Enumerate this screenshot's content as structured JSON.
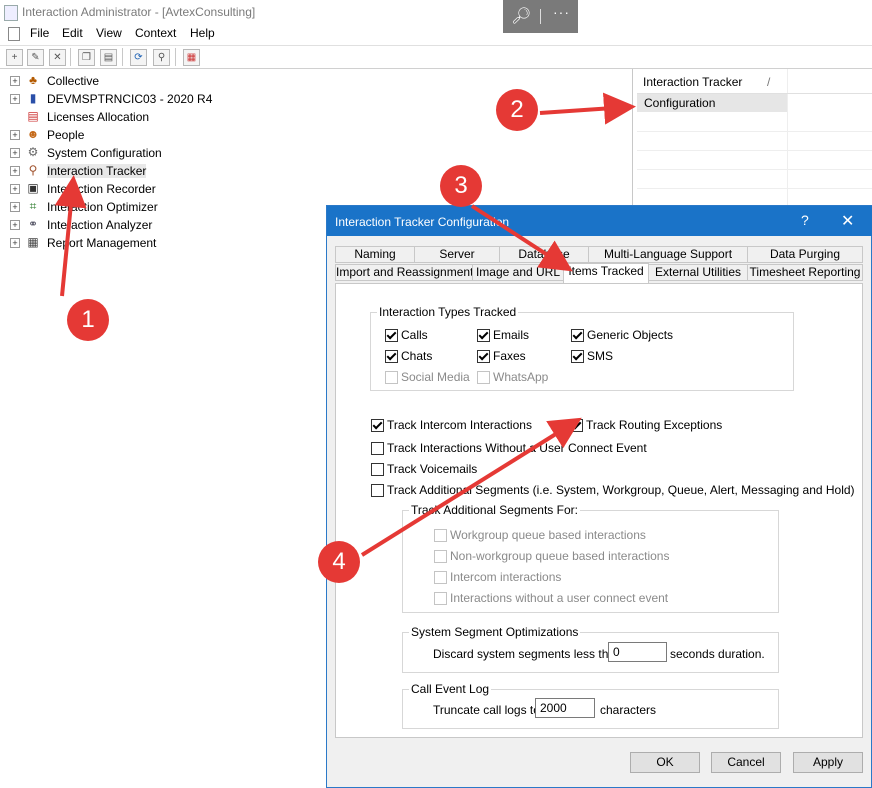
{
  "window": {
    "title": "Interaction Administrator - [AvtexConsulting]"
  },
  "zoom_toolbar": {
    "zoom_icon": "zoom-icon",
    "more": "···"
  },
  "menu": [
    "File",
    "Edit",
    "View",
    "Context",
    "Help"
  ],
  "toolbar_icons": [
    "new-icon",
    "edit-icon",
    "delete-icon",
    "copy-icon",
    "paste-icon",
    "refresh-icon",
    "wizard-icon",
    "report-icon"
  ],
  "tree": {
    "items": [
      {
        "label": "Collective",
        "icon": "collective-icon",
        "expandable": true
      },
      {
        "label": "DEVMSPTRNCIC03 - 2020 R4",
        "icon": "server-icon",
        "expandable": true
      },
      {
        "label": "Licenses Allocation",
        "icon": "license-icon",
        "expandable": false
      },
      {
        "label": "People",
        "icon": "people-icon",
        "expandable": true
      },
      {
        "label": "System Configuration",
        "icon": "system-config-icon",
        "expandable": true
      },
      {
        "label": "Interaction Tracker",
        "icon": "tracker-icon",
        "expandable": true,
        "selected": true
      },
      {
        "label": "Interaction Recorder",
        "icon": "recorder-icon",
        "expandable": true
      },
      {
        "label": "Interaction Optimizer",
        "icon": "optimizer-icon",
        "expandable": true
      },
      {
        "label": "Interaction Analyzer",
        "icon": "analyzer-icon",
        "expandable": true
      },
      {
        "label": "Report Management",
        "icon": "report-icon",
        "expandable": true
      }
    ]
  },
  "right_pane": {
    "header": "Interaction Tracker",
    "header_sep": "/",
    "row": "Configuration"
  },
  "dialog": {
    "title": "Interaction Tracker Configuration",
    "help": "?",
    "close": "✕",
    "tabs_row1": [
      "Naming",
      "Server",
      "Database",
      "Multi-Language Support",
      "Data Purging"
    ],
    "tabs_row2": [
      "Import and Reassignment",
      "Image and URL",
      "Items Tracked",
      "External Utilities",
      "Timesheet Reporting"
    ],
    "active_tab": "Items Tracked",
    "interaction_types": {
      "title": "Interaction Types Tracked",
      "items": [
        {
          "label": "Calls",
          "checked": true,
          "enabled": true
        },
        {
          "label": "Emails",
          "checked": true,
          "enabled": true
        },
        {
          "label": "Generic Objects",
          "checked": true,
          "enabled": true
        },
        {
          "label": "Chats",
          "checked": true,
          "enabled": true
        },
        {
          "label": "Faxes",
          "checked": true,
          "enabled": true
        },
        {
          "label": "SMS",
          "checked": true,
          "enabled": true
        },
        {
          "label": "Social Media",
          "checked": false,
          "enabled": false
        },
        {
          "label": "WhatsApp",
          "checked": false,
          "enabled": false
        }
      ]
    },
    "options": [
      {
        "label": "Track Intercom Interactions",
        "checked": true
      },
      {
        "label": "Track Routing Exceptions",
        "checked": true
      },
      {
        "label": "Track Interactions Without a User Connect Event",
        "checked": false
      },
      {
        "label": "Track Voicemails",
        "checked": false
      },
      {
        "label": "Track Additional Segments (i.e. System, Workgroup, Queue, Alert, Messaging and Hold)",
        "checked": false
      }
    ],
    "additional_segments": {
      "title": "Track Additional Segments For:",
      "items": [
        "Workgroup queue based interactions",
        "Non-workgroup queue based interactions",
        "Intercom interactions",
        "Interactions without a user connect event"
      ]
    },
    "system_segment": {
      "title": "System Segment Optimizations",
      "prefix": "Discard system segments less than",
      "value": "0",
      "suffix": "seconds duration."
    },
    "call_event_log": {
      "title": "Call Event Log",
      "prefix": "Truncate call logs to",
      "value": "2000",
      "suffix": "characters"
    },
    "buttons": {
      "ok": "OK",
      "cancel": "Cancel",
      "apply": "Apply"
    }
  },
  "annotations": [
    "1",
    "2",
    "3",
    "4"
  ],
  "colors": {
    "callout": "#e53935",
    "dialog_title": "#1a73c8"
  }
}
